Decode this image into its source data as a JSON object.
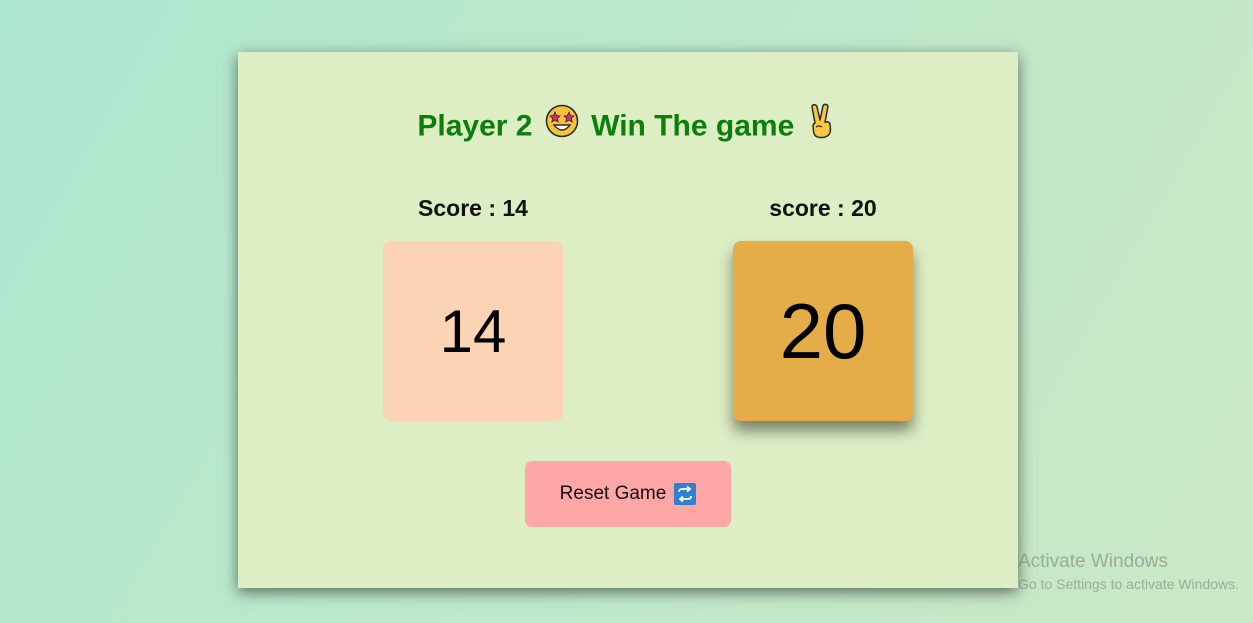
{
  "game": {
    "winner_prefix": "Player 2",
    "winner_emoji": "star-struck-icon",
    "winner_suffix": "Win The game",
    "victory_emoji": "victory-hand-icon"
  },
  "players": [
    {
      "score_label": "Score : 14",
      "dice_value": "14",
      "die_color": "#fdd3b5"
    },
    {
      "score_label": "score : 20",
      "dice_value": "20",
      "die_color": "#e5ad48"
    }
  ],
  "reset_button": {
    "label": "Reset Game",
    "icon": "repeat-icon"
  },
  "colors": {
    "title": "#0a7f0a",
    "card": "#ddedc4",
    "reset_button": "#ffa6a6"
  },
  "watermark": {
    "title": "Activate Windows",
    "subtitle": "Go to Settings to activate Windows."
  }
}
